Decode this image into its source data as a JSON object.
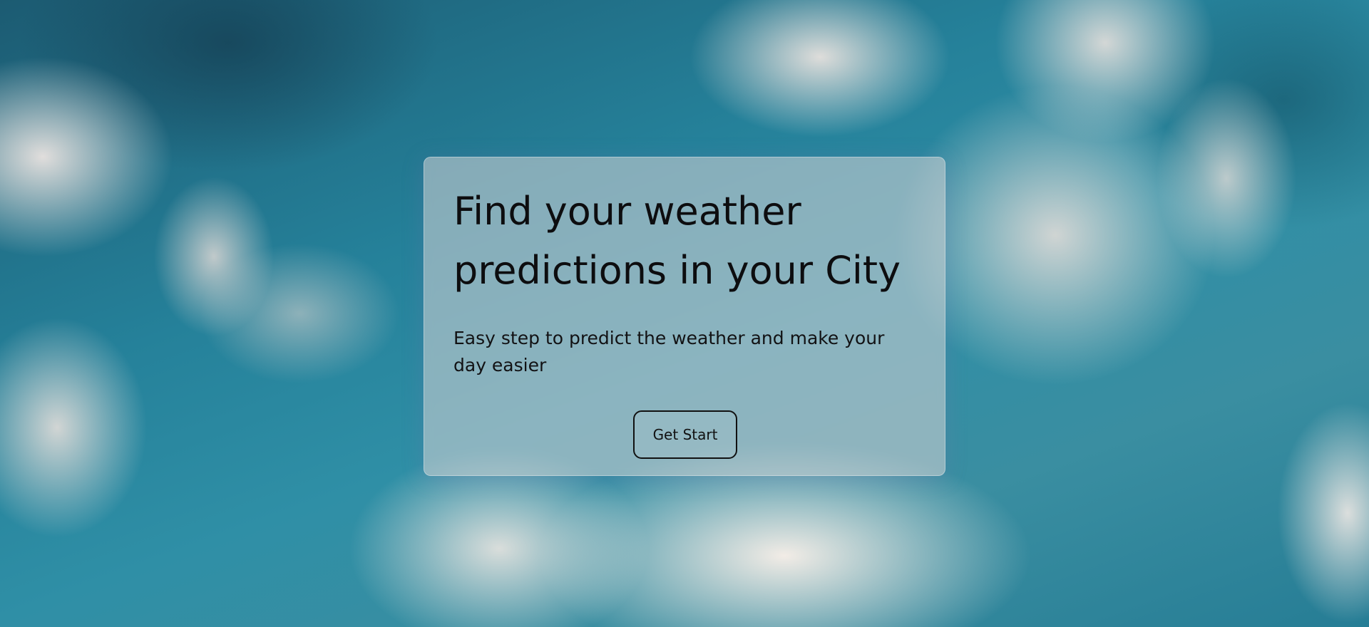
{
  "hero": {
    "title": "Find your weather predictions in your City",
    "subtitle": "Easy step to predict the weather and make your day easier",
    "cta_label": "Get Start"
  },
  "colors": {
    "sky_teal": "#25819a",
    "cloud": "#ece6e1",
    "card_bg": "#d7d4d6",
    "text": "#0d0d0f"
  }
}
